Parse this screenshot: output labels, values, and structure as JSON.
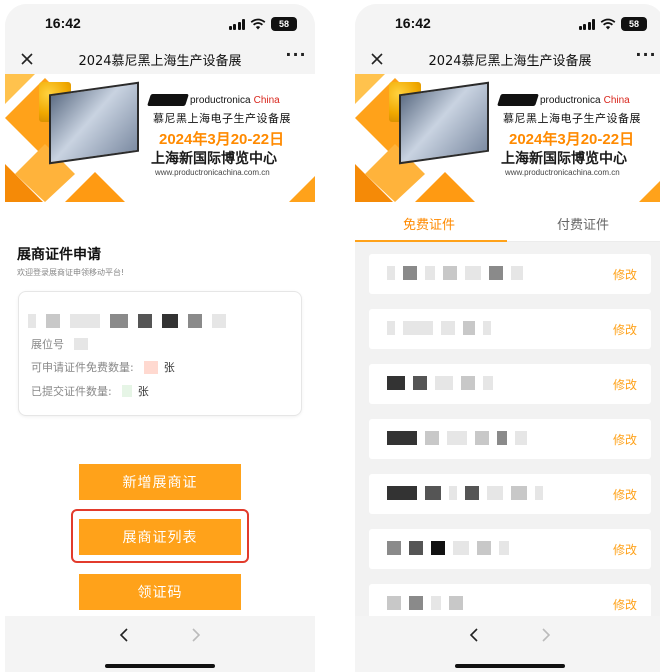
{
  "status_bar": {
    "time": "16:42",
    "battery": "58"
  },
  "nav": {
    "title": "2024慕尼黑上海生产设备展",
    "more": "···"
  },
  "banner": {
    "brand_name": "productronica",
    "brand_region": "China",
    "subtitle": "慕尼黑上海电子生产设备展",
    "date": "2024年3月20-22日",
    "venue": "上海新国际博览中心",
    "url": "www.productronicachina.com.cn"
  },
  "left_screen": {
    "section_title": "展商证件申请",
    "section_subtitle": "欢迎登录展商证申领移动平台!",
    "info": {
      "booth_label": "展位号",
      "free_quota_label": "可申请证件免费数量:",
      "free_quota_unit": "张",
      "submitted_label": "已提交证件数量:",
      "submitted_unit": "张"
    },
    "buttons": {
      "add": "新增展商证",
      "list": "展商证列表",
      "code": "领证码"
    }
  },
  "right_screen": {
    "tabs": {
      "free": "免费证件",
      "paid": "付费证件"
    },
    "edit_label": "修改",
    "item_count": 7
  },
  "colors": {
    "accent": "#ffa21a",
    "highlight": "#e23b2c",
    "date_orange": "#ff8a00"
  }
}
